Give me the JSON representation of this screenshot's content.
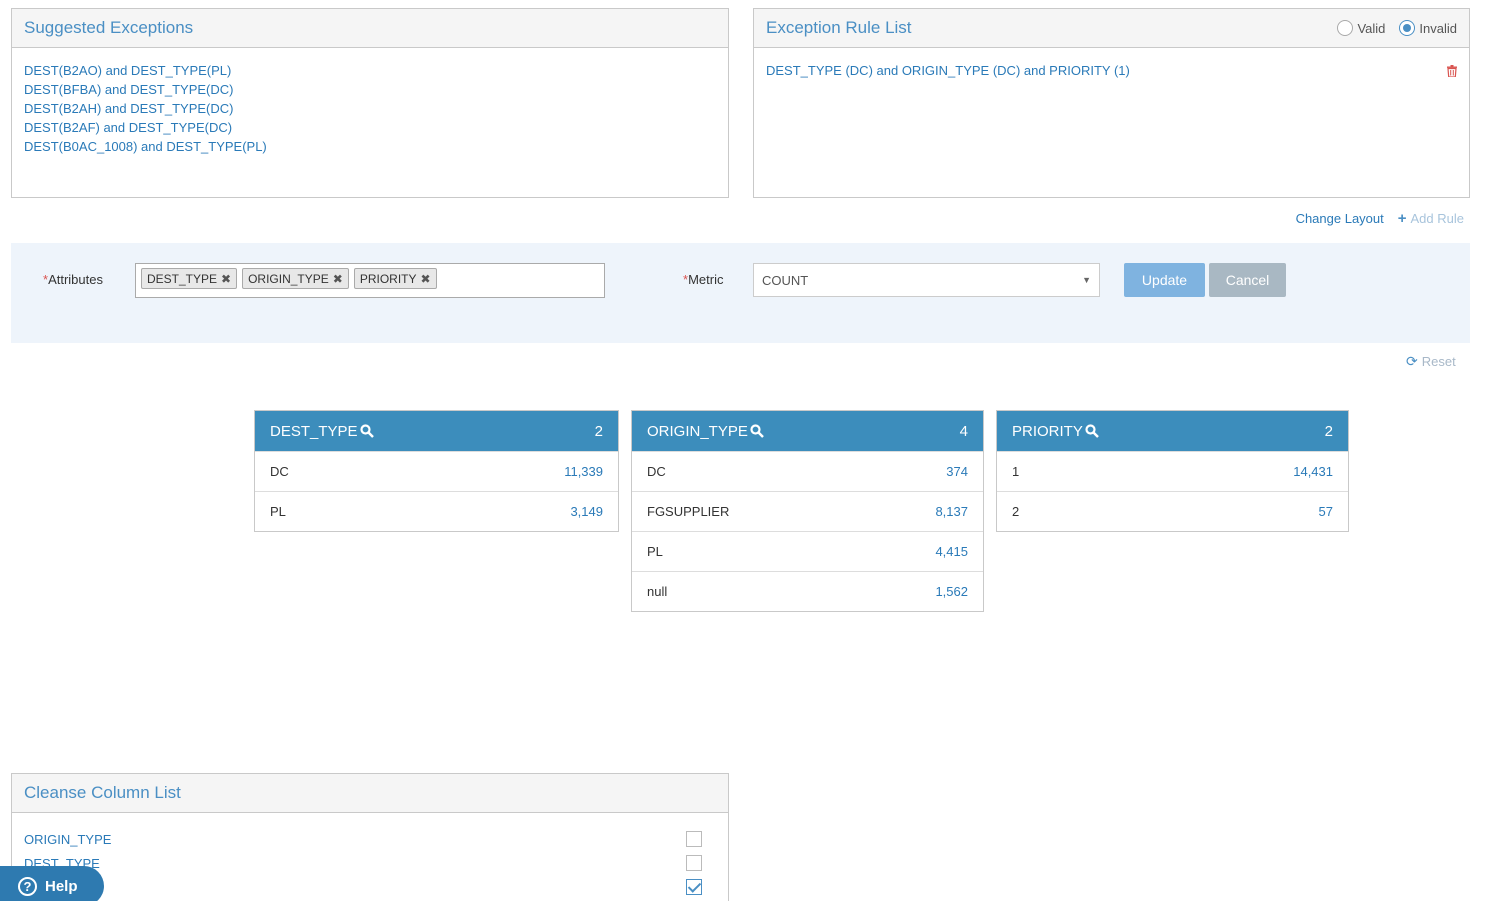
{
  "suggested": {
    "title": "Suggested Exceptions",
    "items": [
      "DEST(B2AO) and DEST_TYPE(PL)",
      "DEST(BFBA) and DEST_TYPE(DC)",
      "DEST(B2AH) and DEST_TYPE(DC)",
      "DEST(B2AF) and DEST_TYPE(DC)",
      "DEST(B0AC_1008) and DEST_TYPE(PL)"
    ]
  },
  "rule_list": {
    "title": "Exception Rule List",
    "radio_valid": "Valid",
    "radio_invalid": "Invalid",
    "selected": "Invalid",
    "rules": [
      "DEST_TYPE (DC) and ORIGIN_TYPE (DC) and PRIORITY (1)"
    ]
  },
  "actions": {
    "change_layout": "Change Layout",
    "add_rule": "Add Rule"
  },
  "filter": {
    "required_mark": "*",
    "attributes_label": "Attributes",
    "tags": [
      "DEST_TYPE",
      "ORIGIN_TYPE",
      "PRIORITY"
    ],
    "metric_label": "Metric",
    "metric_value": "COUNT",
    "update_label": "Update",
    "cancel_label": "Cancel"
  },
  "reset_label": "Reset",
  "tables": [
    {
      "name": "DEST_TYPE",
      "count": "2",
      "rows": [
        [
          "DC",
          "11,339"
        ],
        [
          "PL",
          "3,149"
        ]
      ]
    },
    {
      "name": "ORIGIN_TYPE",
      "count": "4",
      "rows": [
        [
          "DC",
          "374"
        ],
        [
          "FGSUPPLIER",
          "8,137"
        ],
        [
          "PL",
          "4,415"
        ],
        [
          "null",
          "1,562"
        ]
      ]
    },
    {
      "name": "PRIORITY",
      "count": "2",
      "rows": [
        [
          "1",
          "14,431"
        ],
        [
          "2",
          "57"
        ]
      ]
    }
  ],
  "cleanse": {
    "title": "Cleanse Column List",
    "items": [
      {
        "label": "ORIGIN_TYPE",
        "checked": false
      },
      {
        "label": "DEST_TYPE",
        "checked": false
      },
      {
        "label": "",
        "checked": true
      }
    ]
  },
  "help_label": "Help",
  "colors": {
    "accent": "#3c8dbc",
    "link": "#2a7ab8",
    "danger": "#d9534f"
  }
}
